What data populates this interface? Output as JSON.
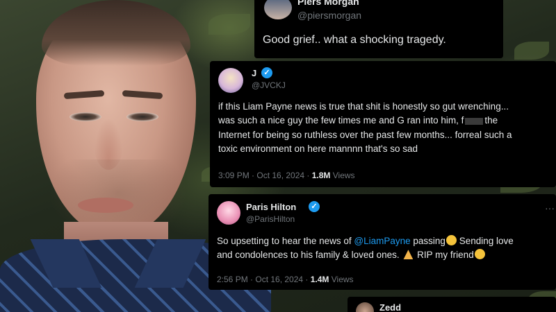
{
  "tweets": [
    {
      "name": "Piers Morgan",
      "handle": "@piersmorgan",
      "text": "Good grief.. what a shocking tragedy."
    },
    {
      "name": "J",
      "handle": "@JVCKJ",
      "lines": [
        "if this Liam Payne news is true that shit is honestly so gut wrenching...",
        "was such a nice guy the few times me and G ran into him, f",
        "the",
        "Internet for being so ruthless over the past few months... forreal such a",
        "toxic environment on here mannnn that's so sad"
      ],
      "time": "3:09 PM · Oct 16, 2024 · ",
      "views": "1.8M",
      "views_label": " Views"
    },
    {
      "name": "Paris Hilton",
      "handle": "@ParisHilton",
      "line1_pre": "So upsetting to hear the news of ",
      "mention": "@LiamPayne",
      "line1_post": " passing",
      "line1_end": " Sending love",
      "line2_pre": "and condolences to his family & loved ones. ",
      "line2_end": " RIP my friend",
      "time": "2:56 PM · Oct 16, 2024 · ",
      "views": "1.4M",
      "views_label": " Views"
    },
    {
      "name": "Zedd"
    }
  ],
  "icons": {
    "verified": "verified-badge-icon",
    "more": "more-options-icon"
  },
  "colors": {
    "card_bg": "#000000",
    "link": "#1d9bf0",
    "muted": "#71767b",
    "text": "#e7e9ea"
  }
}
